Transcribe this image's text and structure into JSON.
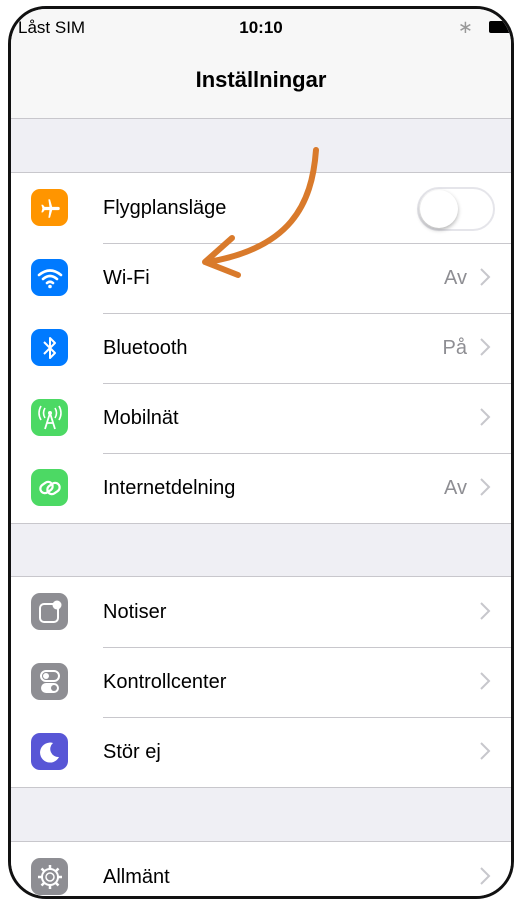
{
  "status": {
    "carrier": "Låst SIM",
    "time": "10:10"
  },
  "nav": {
    "title": "Inställningar"
  },
  "group1": [
    {
      "label": "Flygplansläge",
      "value": "",
      "control": "toggle",
      "toggle_on": false,
      "icon": "airplane-icon",
      "color": "#ff9500"
    },
    {
      "label": "Wi-Fi",
      "value": "Av",
      "control": "chevron",
      "icon": "wifi-icon",
      "color": "#007aff"
    },
    {
      "label": "Bluetooth",
      "value": "På",
      "control": "chevron",
      "icon": "bluetooth-icon",
      "color": "#007aff"
    },
    {
      "label": "Mobilnät",
      "value": "",
      "control": "chevron",
      "icon": "cellular-icon",
      "color": "#4cd964"
    },
    {
      "label": "Internetdelning",
      "value": "Av",
      "control": "chevron",
      "icon": "hotspot-icon",
      "color": "#4cd964"
    }
  ],
  "group2": [
    {
      "label": "Notiser",
      "value": "",
      "control": "chevron",
      "icon": "notifications-icon",
      "color": "#8e8e93"
    },
    {
      "label": "Kontrollcenter",
      "value": "",
      "control": "chevron",
      "icon": "control-center-icon",
      "color": "#8e8e93"
    },
    {
      "label": "Stör ej",
      "value": "",
      "control": "chevron",
      "icon": "moon-icon",
      "color": "#5856d6"
    }
  ],
  "group3": [
    {
      "label": "Allmänt",
      "value": "",
      "control": "chevron",
      "icon": "gear-icon",
      "color": "#8e8e93"
    }
  ],
  "annotation": {
    "color": "#d97a2b",
    "points_to": "Wi-Fi"
  }
}
